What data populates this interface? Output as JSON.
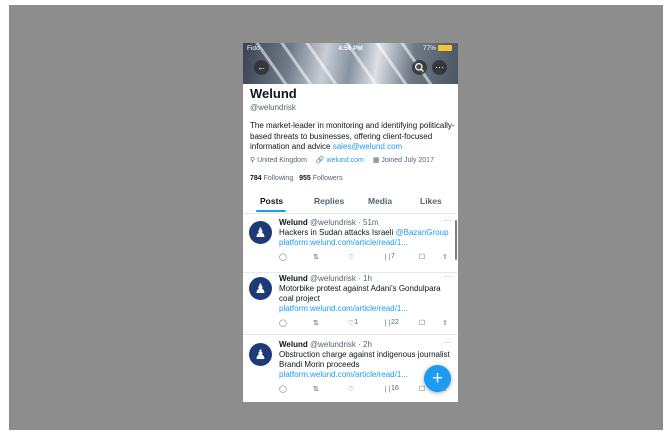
{
  "status_bar": {
    "carrier": "Fido",
    "time": "4:56 PM",
    "battery": "77%"
  },
  "banner": {
    "back_icon": "back-arrow-icon",
    "search_icon": "search-icon",
    "more_icon": "more-icon"
  },
  "profile": {
    "name": "Welund",
    "handle": "@welundrisk",
    "bio": "The market-leader in monitoring and identifying politically-based threats to businesses, offering client-focused information and advice ",
    "bio_email": "sales@welund.com",
    "location": "United Kingdom",
    "website": "welund.com",
    "joined": "Joined July 2017",
    "following_count": "784",
    "following_label": "Following",
    "followers_count": "955",
    "followers_label": "Followers"
  },
  "tabs": [
    {
      "label": "Posts",
      "active": true
    },
    {
      "label": "Replies",
      "active": false
    },
    {
      "label": "Media",
      "active": false
    },
    {
      "label": "Likes",
      "active": false
    }
  ],
  "posts": [
    {
      "author": "Welund",
      "meta": "@welundrisk · 51m",
      "text": "Hackers in Sudan attacks Israeli ",
      "mention": "@BazanGroup",
      "link": "platform.welund.com/article/read/1...",
      "replies": "",
      "reposts": "",
      "likes": "",
      "views": "7"
    },
    {
      "author": "Welund",
      "meta": "@welundrisk · 1h",
      "text": "Motorbike protest against Adani's Gondulpara coal project",
      "mention": "",
      "link": "platform.welund.com/article/read/1...",
      "replies": "",
      "reposts": "",
      "likes": "1",
      "views": "22"
    },
    {
      "author": "Welund",
      "meta": "@welundrisk · 2h",
      "text": "Obstruction charge against indigenous journalist Brandi Morin proceeds",
      "mention": "",
      "link": "platform.welund.com/article/read/1...",
      "replies": "",
      "reposts": "",
      "likes": "",
      "views": "16"
    }
  ],
  "fab": {
    "label": "+"
  },
  "colors": {
    "accent": "#1d9bf0",
    "text": "#0f1419",
    "muted": "#536471",
    "backdrop": "#8d8d8d"
  }
}
